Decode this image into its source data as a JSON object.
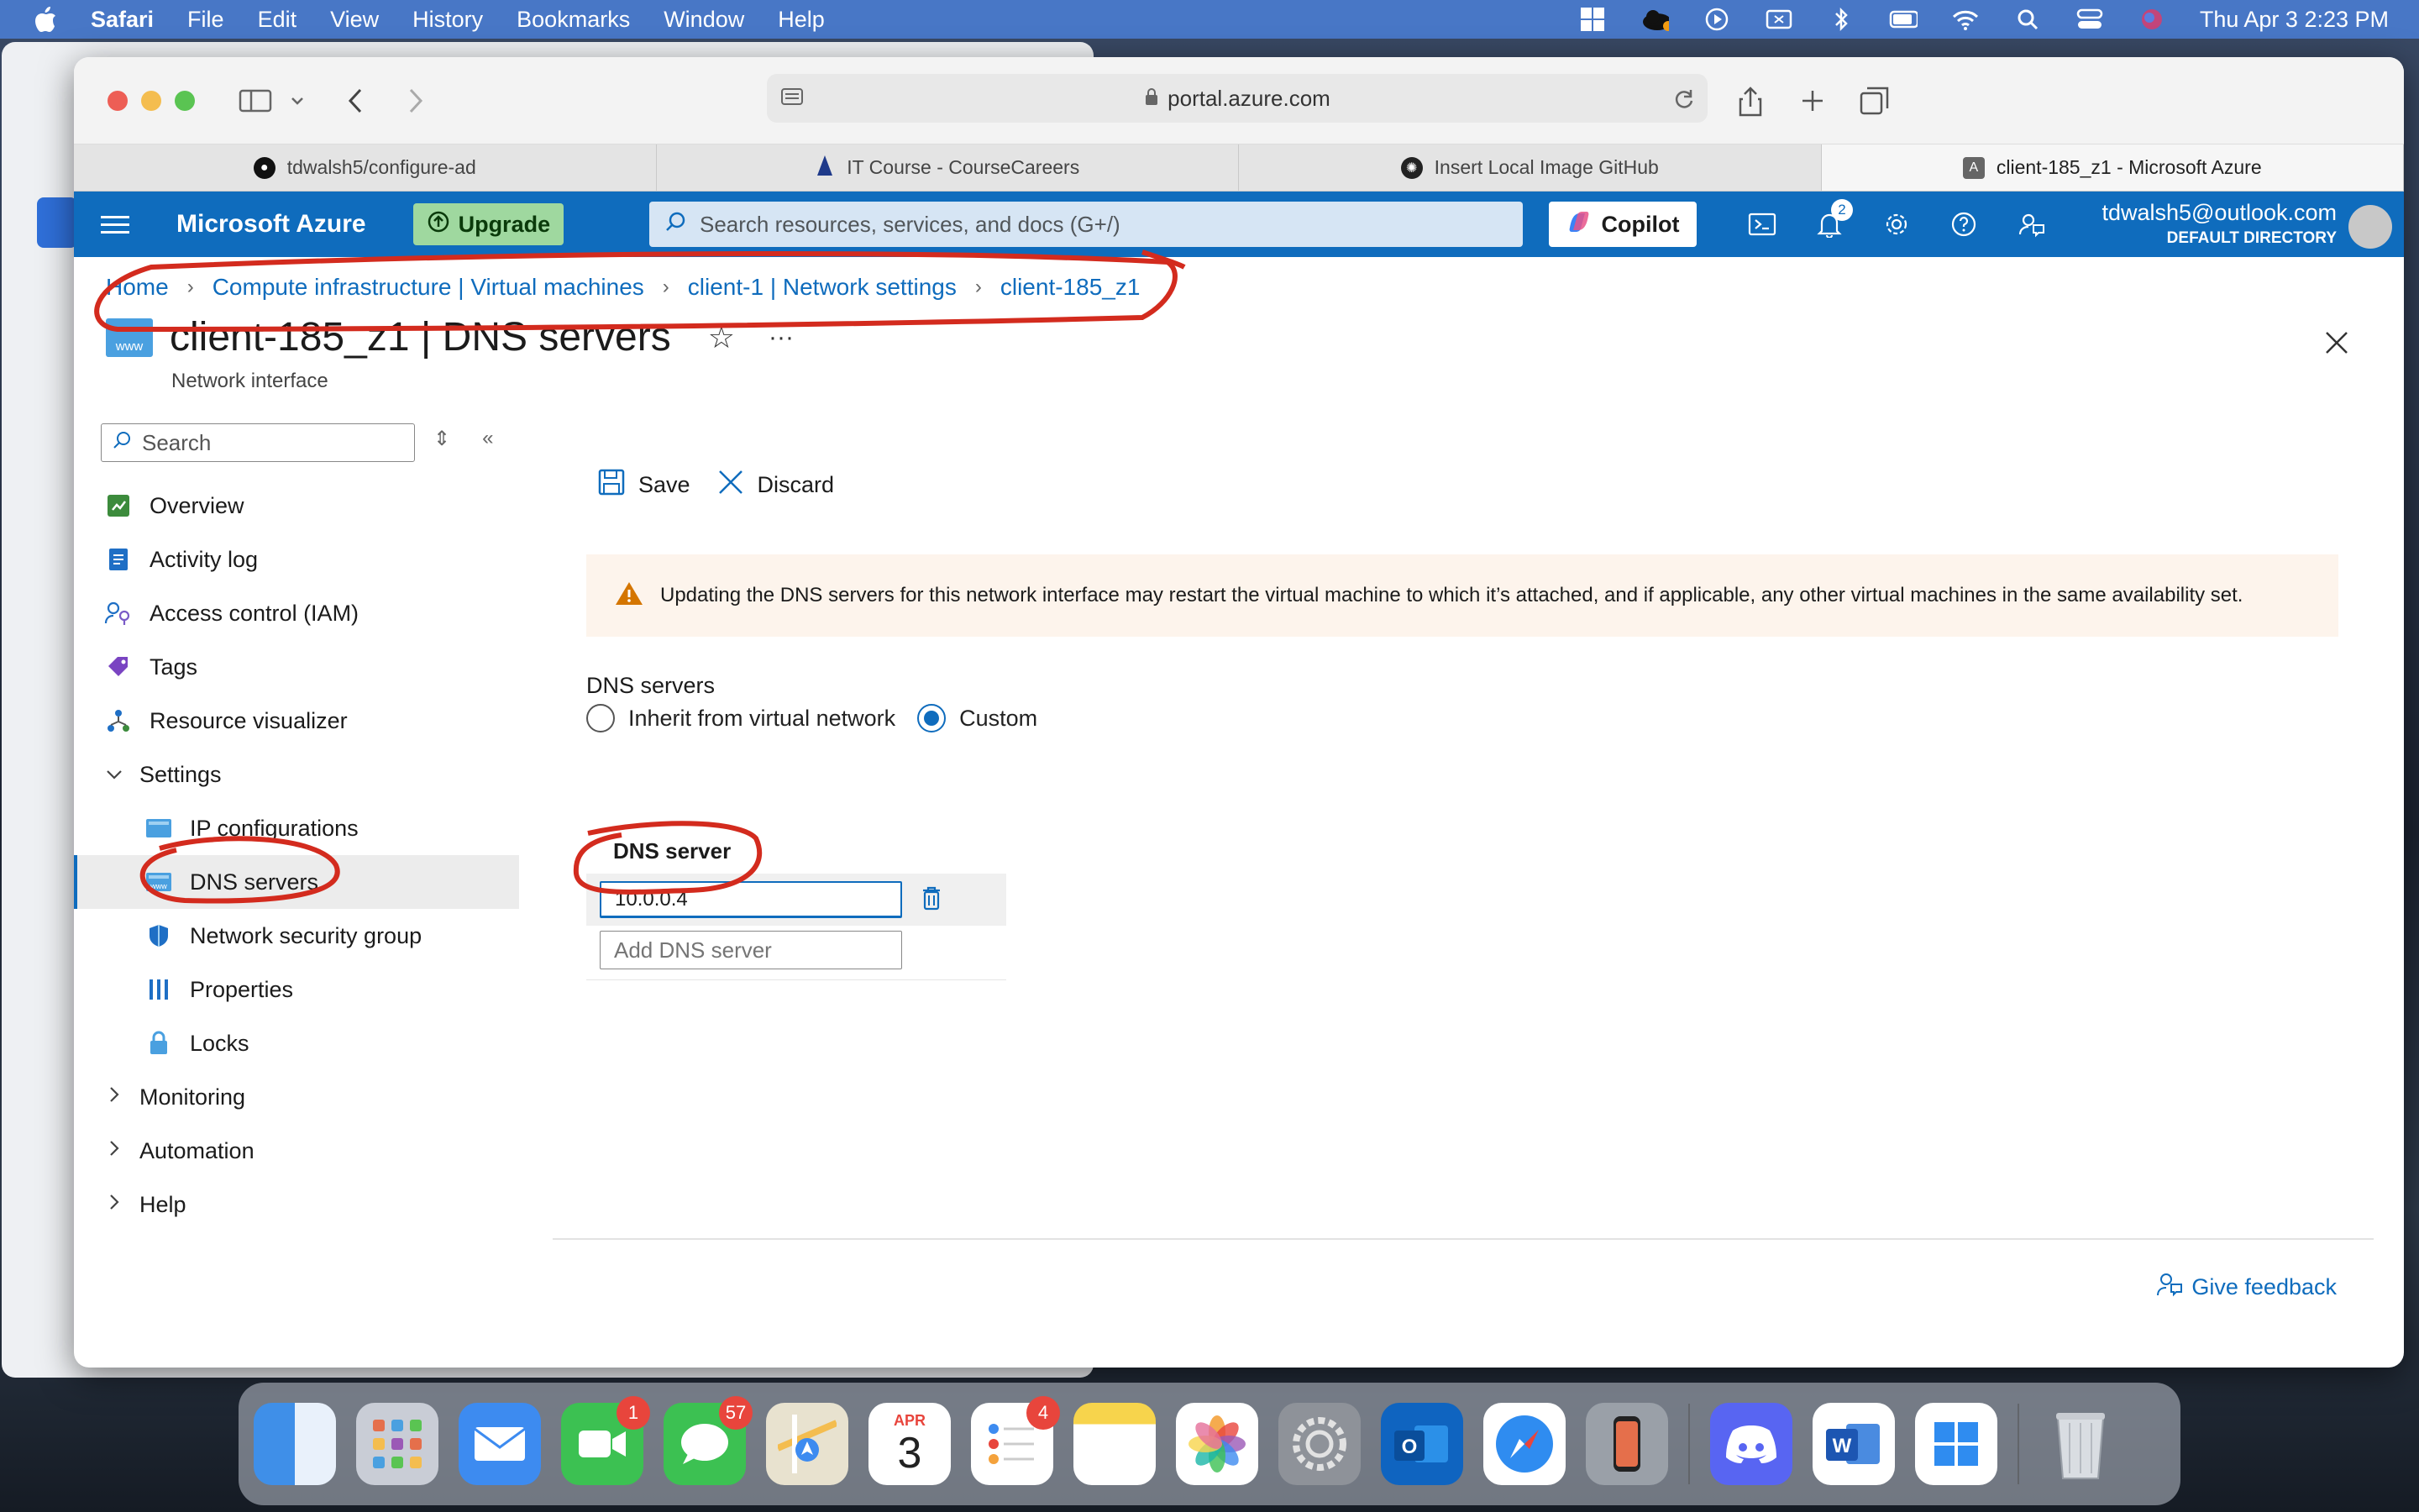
{
  "menubar": {
    "app": "Safari",
    "items": [
      "File",
      "Edit",
      "View",
      "History",
      "Bookmarks",
      "Window",
      "Help"
    ],
    "clock": "Thu Apr 3  2:23 PM"
  },
  "browser": {
    "address": "portal.azure.com",
    "tabs": [
      {
        "label": "tdwalsh5/configure-ad",
        "icon": "github-icon"
      },
      {
        "label": "IT Course - CourseCareers",
        "icon": "sail-icon"
      },
      {
        "label": "Insert Local Image GitHub",
        "icon": "openai-icon"
      },
      {
        "label": "client-185_z1 - Microsoft Azure",
        "icon": "azure-icon"
      }
    ]
  },
  "azure": {
    "brand": "Microsoft Azure",
    "upgrade": "Upgrade",
    "search_placeholder": "Search resources, services, and docs (G+/)",
    "copilot": "Copilot",
    "notifications_count": "2",
    "account_email": "tdwalsh5@outlook.com",
    "account_directory": "DEFAULT DIRECTORY"
  },
  "breadcrumb": [
    "Home",
    "Compute infrastructure | Virtual machines",
    "client-1 | Network settings",
    "client-185_z1"
  ],
  "page": {
    "title": "client-185_z1 | DNS servers",
    "subtitle": "Network interface",
    "page_icon_text": "www"
  },
  "sidebar": {
    "search_placeholder": "Search",
    "items": [
      {
        "label": "Overview",
        "icon": "overview-icon"
      },
      {
        "label": "Activity log",
        "icon": "activity-log-icon"
      },
      {
        "label": "Access control (IAM)",
        "icon": "iam-icon"
      },
      {
        "label": "Tags",
        "icon": "tag-icon"
      },
      {
        "label": "Resource visualizer",
        "icon": "visualizer-icon"
      },
      {
        "label": "Settings",
        "icon": "chevron-down-icon"
      },
      {
        "label": "IP configurations",
        "icon": "ip-config-icon"
      },
      {
        "label": "DNS servers",
        "icon": "dns-icon"
      },
      {
        "label": "Network security group",
        "icon": "shield-icon"
      },
      {
        "label": "Properties",
        "icon": "properties-icon"
      },
      {
        "label": "Locks",
        "icon": "lock-icon"
      },
      {
        "label": "Monitoring",
        "icon": "chevron-right-icon"
      },
      {
        "label": "Automation",
        "icon": "chevron-right-icon"
      },
      {
        "label": "Help",
        "icon": "chevron-right-icon"
      }
    ]
  },
  "commands": {
    "save": "Save",
    "discard": "Discard"
  },
  "warning": "Updating the DNS servers for this network interface may restart the virtual machine to which it’s attached, and if applicable, any other virtual machines in the same availability set.",
  "dns": {
    "label": "DNS servers",
    "options": [
      "Inherit from virtual network",
      "Custom"
    ],
    "selected": "Custom",
    "column_header": "DNS server",
    "value": "10.0.0.4",
    "add_placeholder": "Add DNS server"
  },
  "feedback": "Give feedback",
  "dock": {
    "badges": {
      "facetime": "1",
      "messages": "57",
      "reminders": "4"
    },
    "calendar_month": "APR",
    "calendar_day": "3"
  },
  "colors": {
    "azure_blue": "#0f6cbd",
    "annotation_red": "#d32b1e",
    "warning_orange": "#d47500"
  }
}
